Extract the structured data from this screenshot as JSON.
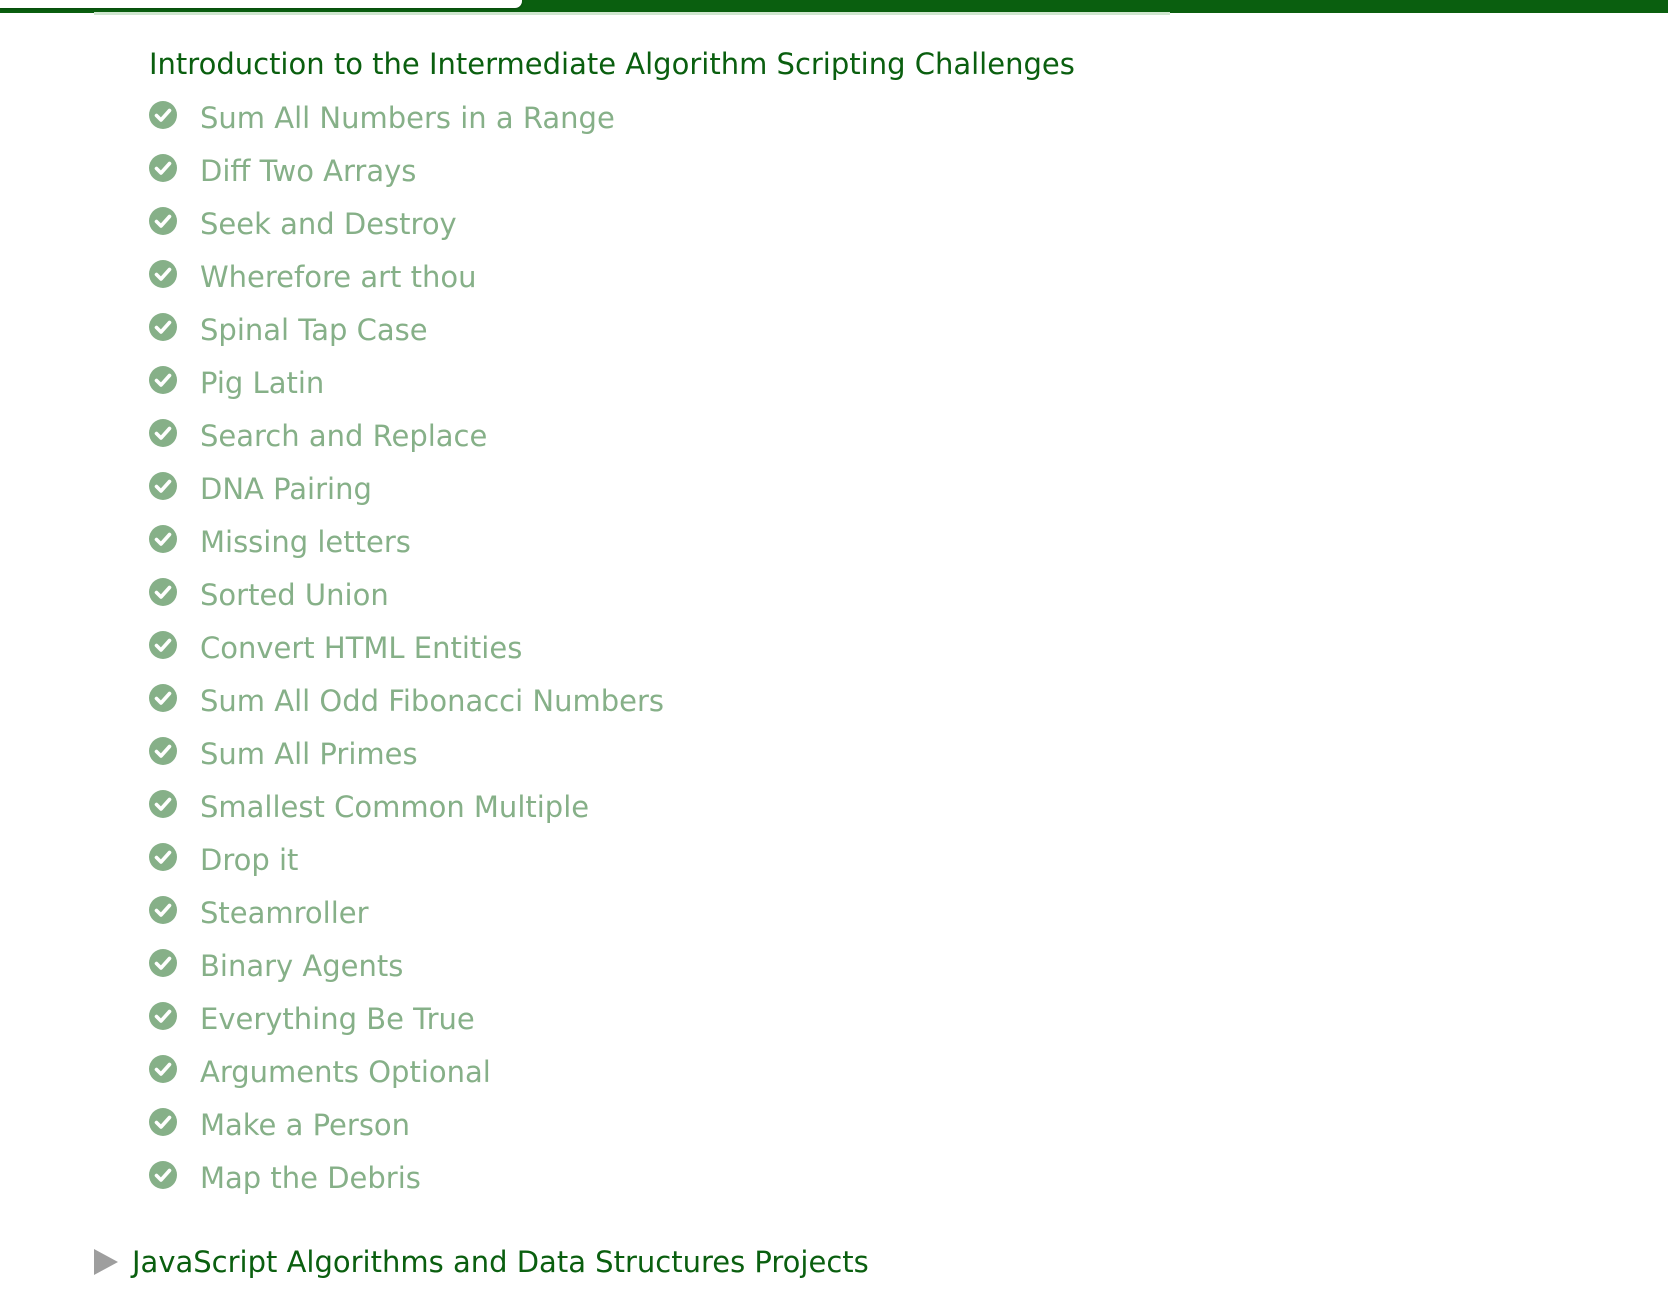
{
  "colors": {
    "brand_dark_green": "#0a5f0f",
    "completed_text": "#86b088",
    "check_icon": "#86b088",
    "collapse_arrow": "#9e9e9e"
  },
  "section": {
    "title": "Introduction to the Intermediate Algorithm Scripting Challenges"
  },
  "challenges": [
    {
      "label": "Sum All Numbers in a Range",
      "icon": "check-circle-icon",
      "completed": true
    },
    {
      "label": "Diff Two Arrays",
      "icon": "check-circle-icon",
      "completed": true
    },
    {
      "label": "Seek and Destroy",
      "icon": "check-circle-icon",
      "completed": true
    },
    {
      "label": "Wherefore art thou",
      "icon": "check-circle-icon",
      "completed": true
    },
    {
      "label": "Spinal Tap Case",
      "icon": "check-circle-icon",
      "completed": true
    },
    {
      "label": "Pig Latin",
      "icon": "check-circle-icon",
      "completed": true
    },
    {
      "label": "Search and Replace",
      "icon": "check-circle-icon",
      "completed": true
    },
    {
      "label": "DNA Pairing",
      "icon": "check-circle-icon",
      "completed": true
    },
    {
      "label": "Missing letters",
      "icon": "check-circle-icon",
      "completed": true
    },
    {
      "label": "Sorted Union",
      "icon": "check-circle-icon",
      "completed": true
    },
    {
      "label": "Convert HTML Entities",
      "icon": "check-circle-icon",
      "completed": true
    },
    {
      "label": "Sum All Odd Fibonacci Numbers",
      "icon": "check-circle-icon",
      "completed": true
    },
    {
      "label": "Sum All Primes",
      "icon": "check-circle-icon",
      "completed": true
    },
    {
      "label": "Smallest Common Multiple",
      "icon": "check-circle-icon",
      "completed": true
    },
    {
      "label": "Drop it",
      "icon": "check-circle-icon",
      "completed": true
    },
    {
      "label": "Steamroller",
      "icon": "check-circle-icon",
      "completed": true
    },
    {
      "label": "Binary Agents",
      "icon": "check-circle-icon",
      "completed": true
    },
    {
      "label": "Everything Be True",
      "icon": "check-circle-icon",
      "completed": true
    },
    {
      "label": "Arguments Optional",
      "icon": "check-circle-icon",
      "completed": true
    },
    {
      "label": "Make a Person",
      "icon": "check-circle-icon",
      "completed": true
    },
    {
      "label": "Map the Debris",
      "icon": "check-circle-icon",
      "completed": true
    }
  ],
  "next_section": {
    "label": "JavaScript Algorithms and Data Structures Projects",
    "icon": "caret-right-icon",
    "expanded": false
  }
}
